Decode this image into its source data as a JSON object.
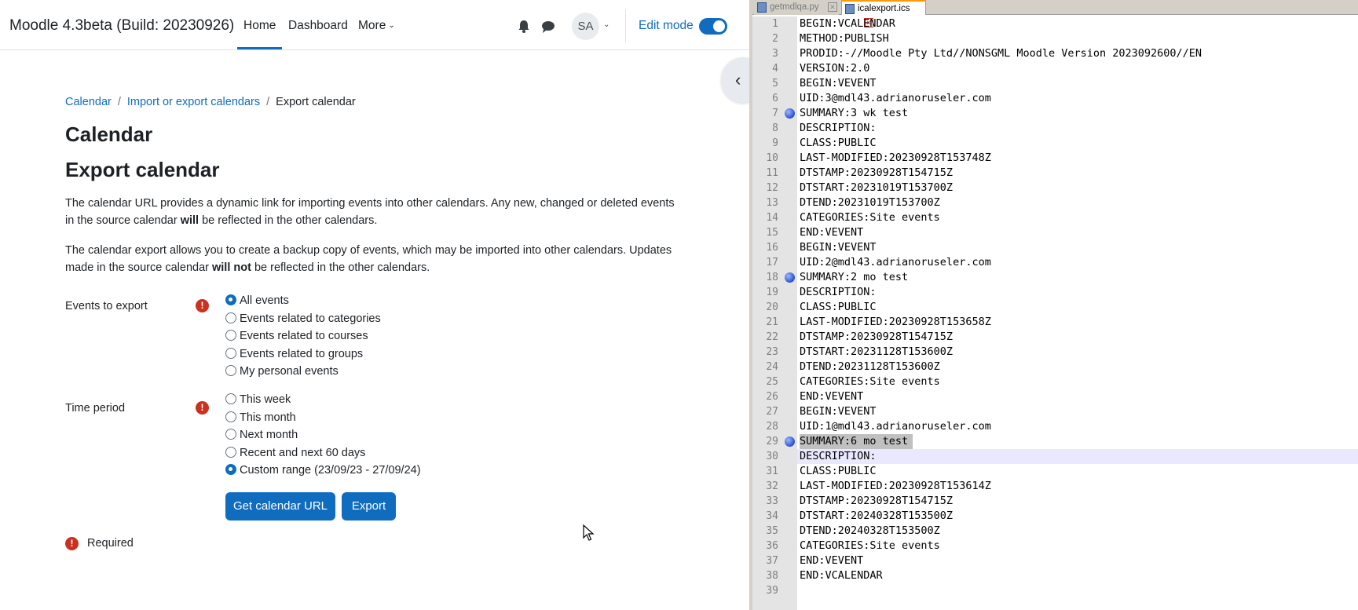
{
  "moodle": {
    "brand": "Moodle 4.3beta (Build: 20230926)",
    "nav": {
      "home": "Home",
      "dashboard": "Dashboard",
      "more": "More"
    },
    "user_initials": "SA",
    "edit_mode_label": "Edit mode",
    "edit_mode_on": true,
    "breadcrumb": {
      "item1": "Calendar",
      "item2": "Import or export calendars",
      "current": "Export calendar",
      "separator": "/"
    },
    "heading1": "Calendar",
    "heading2": "Export calendar",
    "para1": {
      "before": "The calendar URL provides a dynamic link for importing events into other calendars. Any new, changed or deleted events in the source calendar ",
      "bold": "will",
      "after": " be reflected in the other calendars."
    },
    "para2": {
      "before": "The calendar export allows you to create a backup copy of events, which may be imported into other calendars. Updates made in the source calendar ",
      "bold": "will not",
      "after": " be reflected in the other calendars."
    },
    "events_field": {
      "label": "Events to export",
      "options": [
        "All events",
        "Events related to categories",
        "Events related to courses",
        "Events related to groups",
        "My personal events"
      ],
      "selected": "All events"
    },
    "time_field": {
      "label": "Time period",
      "options": [
        "This week",
        "This month",
        "Next month",
        "Recent and next 60 days",
        "Custom range (23/09/23 - 27/09/24)"
      ],
      "selected": "Custom range (23/09/23 - 27/09/24)"
    },
    "buttons": {
      "get_url": "Get calendar URL",
      "export": "Export"
    },
    "required_text": "Required",
    "required_icon_glyph": "!"
  },
  "editor": {
    "tabs": [
      {
        "label": "getmdlqa.py",
        "active": false
      },
      {
        "label": "icalexport.ics",
        "active": true
      }
    ],
    "bookmarked_lines": [
      7,
      18,
      29
    ],
    "current_line": 30,
    "selected_line": 29,
    "lines": [
      "BEGIN:VCALENDAR",
      "METHOD:PUBLISH",
      "PRODID:-//Moodle Pty Ltd//NONSGML Moodle Version 2023092600//EN",
      "VERSION:2.0",
      "BEGIN:VEVENT",
      "UID:3@mdl43.adrianoruseler.com",
      "SUMMARY:3 wk test",
      "DESCRIPTION:",
      "CLASS:PUBLIC",
      "LAST-MODIFIED:20230928T153748Z",
      "DTSTAMP:20230928T154715Z",
      "DTSTART:20231019T153700Z",
      "DTEND:20231019T153700Z",
      "CATEGORIES:Site events",
      "END:VEVENT",
      "BEGIN:VEVENT",
      "UID:2@mdl43.adrianoruseler.com",
      "SUMMARY:2 mo test",
      "DESCRIPTION:",
      "CLASS:PUBLIC",
      "LAST-MODIFIED:20230928T153658Z",
      "DTSTAMP:20230928T154715Z",
      "DTSTART:20231128T153600Z",
      "DTEND:20231128T153600Z",
      "CATEGORIES:Site events",
      "END:VEVENT",
      "BEGIN:VEVENT",
      "UID:1@mdl43.adrianoruseler.com",
      "SUMMARY:6 mo test",
      "DESCRIPTION:",
      "CLASS:PUBLIC",
      "LAST-MODIFIED:20230928T153614Z",
      "DTSTAMP:20230928T154715Z",
      "DTSTART:20240328T153500Z",
      "DTEND:20240328T153500Z",
      "CATEGORIES:Site events",
      "END:VEVENT",
      "END:VCALENDAR",
      ""
    ]
  }
}
